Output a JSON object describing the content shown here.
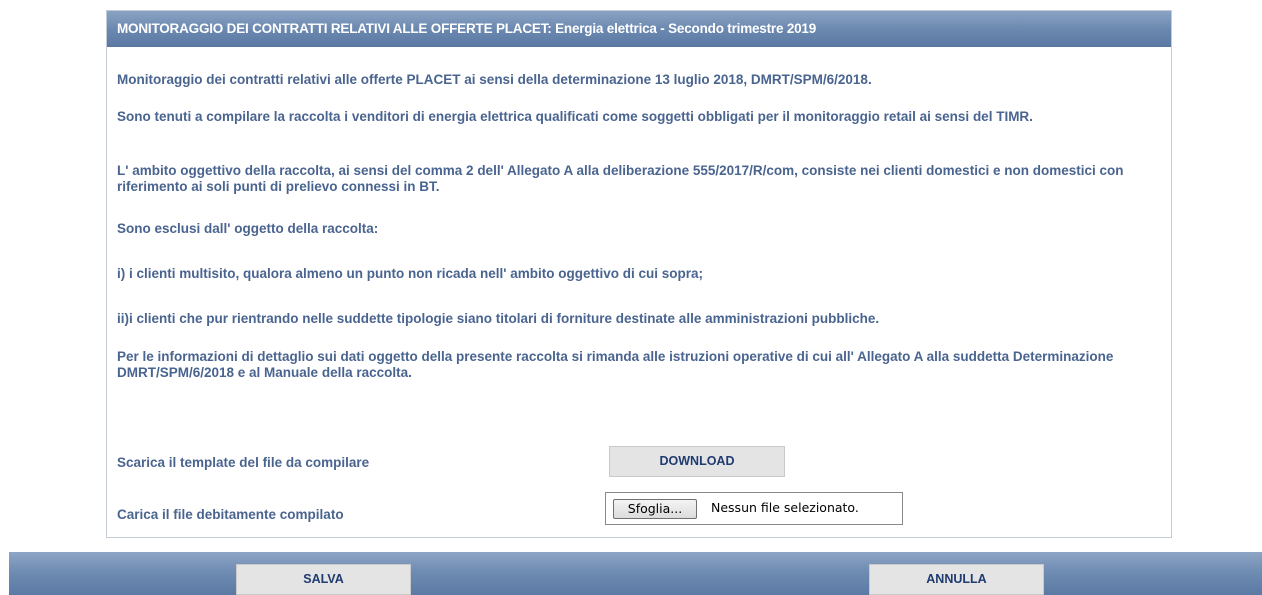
{
  "header": {
    "title": "MONITORAGGIO DEI CONTRATTI RELATIVI ALLE OFFERTE PLACET: Energia elettrica - Secondo trimestre 2019"
  },
  "body": {
    "paragraphs": [
      "Monitoraggio dei contratti relativi alle offerte PLACET ai sensi della determinazione 13 luglio 2018, DMRT/SPM/6/2018.",
      "Sono tenuti a compilare la raccolta i venditori di energia elettrica qualificati come soggetti obbligati per il monitoraggio retail ai sensi del TIMR.",
      "L' ambito oggettivo della raccolta, ai sensi del comma 2 dell' Allegato A alla deliberazione 555/2017/R/com, consiste nei clienti domestici e non domestici con riferimento ai soli punti di prelievo connessi in BT.",
      "Sono esclusi dall' oggetto della raccolta:",
      "i) i clienti multisito, qualora almeno un punto non ricada nell' ambito oggettivo di cui sopra;",
      "ii)i clienti che pur rientrando nelle suddette tipologie siano titolari di forniture destinate alle amministrazioni pubbliche.",
      "Per le informazioni di dettaglio sui dati oggetto della presente raccolta si rimanda alle istruzioni operative di cui all' Allegato A alla suddetta Determinazione DMRT/SPM/6/2018 e al Manuale della raccolta."
    ]
  },
  "download": {
    "label": "Scarica il template del file da compilare",
    "button": "DOWNLOAD"
  },
  "upload": {
    "label": "Carica il file debitamente compilato",
    "browse_button": "Sfoglia...",
    "status": "Nessun file selezionato."
  },
  "footer": {
    "save_label": "SALVA",
    "cancel_label": "ANNULLA"
  },
  "colors": {
    "header_bg": "#6c89b0",
    "text": "#4a6490",
    "button_bg": "#e4e4e4",
    "button_text": "#1f3b70"
  }
}
